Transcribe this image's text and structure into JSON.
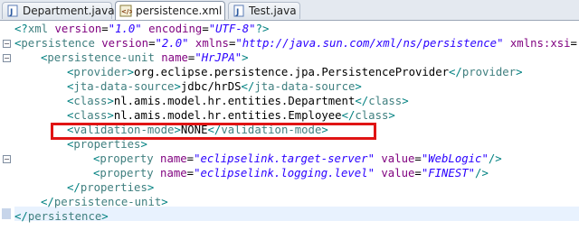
{
  "tabs": [
    {
      "label": "Department.java",
      "icon": "java-file-icon",
      "active": false
    },
    {
      "label": "persistence.xml",
      "icon": "xml-file-icon",
      "active": true
    },
    {
      "label": "Test.java",
      "icon": "java-file-icon",
      "active": false
    }
  ],
  "lines": [
    {
      "indent": 0,
      "tokens": [
        [
          "punct",
          "<?"
        ],
        [
          "tag",
          "xml"
        ],
        [
          "txt",
          " "
        ],
        [
          "attr",
          "version"
        ],
        [
          "txt",
          "="
        ],
        [
          "val",
          "\"1.0\""
        ],
        [
          "txt",
          " "
        ],
        [
          "attr",
          "encoding"
        ],
        [
          "txt",
          "="
        ],
        [
          "val",
          "\"UTF-8\""
        ],
        [
          "punct",
          "?>"
        ]
      ]
    },
    {
      "indent": 0,
      "tokens": [
        [
          "punct",
          "<"
        ],
        [
          "tag",
          "persistence"
        ],
        [
          "txt",
          " "
        ],
        [
          "attr",
          "version"
        ],
        [
          "txt",
          "="
        ],
        [
          "val",
          "\"2.0\""
        ],
        [
          "txt",
          " "
        ],
        [
          "attr",
          "xmlns"
        ],
        [
          "txt",
          "="
        ],
        [
          "val",
          "\"http://java.sun.com/xml/ns/persistence\""
        ],
        [
          "txt",
          " "
        ],
        [
          "attr",
          "xmlns:xsi"
        ],
        [
          "txt",
          "="
        ],
        [
          "val",
          "\"h"
        ]
      ]
    },
    {
      "indent": 1,
      "tokens": [
        [
          "punct",
          "<"
        ],
        [
          "tag",
          "persistence-unit"
        ],
        [
          "txt",
          " "
        ],
        [
          "attr",
          "name"
        ],
        [
          "txt",
          "="
        ],
        [
          "val",
          "\"HrJPA\""
        ],
        [
          "punct",
          ">"
        ]
      ]
    },
    {
      "indent": 2,
      "tokens": [
        [
          "punct",
          "<"
        ],
        [
          "tag",
          "provider"
        ],
        [
          "punct",
          ">"
        ],
        [
          "txt",
          "org.eclipse.persistence.jpa.PersistenceProvider"
        ],
        [
          "punct",
          "</"
        ],
        [
          "tag",
          "provider"
        ],
        [
          "punct",
          ">"
        ]
      ]
    },
    {
      "indent": 2,
      "tokens": [
        [
          "punct",
          "<"
        ],
        [
          "tag",
          "jta-data-source"
        ],
        [
          "punct",
          ">"
        ],
        [
          "txt",
          "jdbc/hrDS"
        ],
        [
          "punct",
          "</"
        ],
        [
          "tag",
          "jta-data-source"
        ],
        [
          "punct",
          ">"
        ]
      ]
    },
    {
      "indent": 2,
      "tokens": [
        [
          "punct",
          "<"
        ],
        [
          "tag",
          "class"
        ],
        [
          "punct",
          ">"
        ],
        [
          "txt",
          "nl.amis.model.hr.entities.Department"
        ],
        [
          "punct",
          "</"
        ],
        [
          "tag",
          "class"
        ],
        [
          "punct",
          ">"
        ]
      ]
    },
    {
      "indent": 2,
      "tokens": [
        [
          "punct",
          "<"
        ],
        [
          "tag",
          "class"
        ],
        [
          "punct",
          ">"
        ],
        [
          "txt",
          "nl.amis.model.hr.entities.Employee"
        ],
        [
          "punct",
          "</"
        ],
        [
          "tag",
          "class"
        ],
        [
          "punct",
          ">"
        ]
      ]
    },
    {
      "indent": 2,
      "tokens": [
        [
          "punct",
          "<"
        ],
        [
          "tag",
          "validation-mode"
        ],
        [
          "punct",
          ">"
        ],
        [
          "txt",
          "NONE"
        ],
        [
          "punct",
          "</"
        ],
        [
          "tag",
          "validation-mode"
        ],
        [
          "punct",
          ">"
        ]
      ]
    },
    {
      "indent": 2,
      "tokens": [
        [
          "punct",
          "<"
        ],
        [
          "tag",
          "properties"
        ],
        [
          "punct",
          ">"
        ]
      ]
    },
    {
      "indent": 3,
      "tokens": [
        [
          "punct",
          "<"
        ],
        [
          "tag",
          "property"
        ],
        [
          "txt",
          " "
        ],
        [
          "attr",
          "name"
        ],
        [
          "txt",
          "="
        ],
        [
          "val",
          "\"eclipselink.target-server\""
        ],
        [
          "txt",
          " "
        ],
        [
          "attr",
          "value"
        ],
        [
          "txt",
          "="
        ],
        [
          "val",
          "\"WebLogic\""
        ],
        [
          "punct",
          "/>"
        ]
      ]
    },
    {
      "indent": 3,
      "tokens": [
        [
          "punct",
          "<"
        ],
        [
          "tag",
          "property"
        ],
        [
          "txt",
          " "
        ],
        [
          "attr",
          "name"
        ],
        [
          "txt",
          "="
        ],
        [
          "val",
          "\"eclipselink.logging.level\""
        ],
        [
          "txt",
          " "
        ],
        [
          "attr",
          "value"
        ],
        [
          "txt",
          "="
        ],
        [
          "val",
          "\"FINEST\""
        ],
        [
          "punct",
          "/>"
        ]
      ]
    },
    {
      "indent": 2,
      "tokens": [
        [
          "punct",
          "</"
        ],
        [
          "tag",
          "properties"
        ],
        [
          "punct",
          ">"
        ]
      ]
    },
    {
      "indent": 1,
      "tokens": [
        [
          "punct",
          "</"
        ],
        [
          "tag",
          "persistence-unit"
        ],
        [
          "punct",
          ">"
        ]
      ]
    },
    {
      "indent": 0,
      "tokens": [
        [
          "punct",
          "</"
        ],
        [
          "tag",
          "persistence"
        ],
        [
          "punct",
          ">"
        ]
      ]
    }
  ],
  "highlighted_line": 8,
  "colors": {
    "highlight_border": "#e01414",
    "tag": "#3f7f7f",
    "attr": "#7f007f",
    "value": "#2a00ff"
  }
}
